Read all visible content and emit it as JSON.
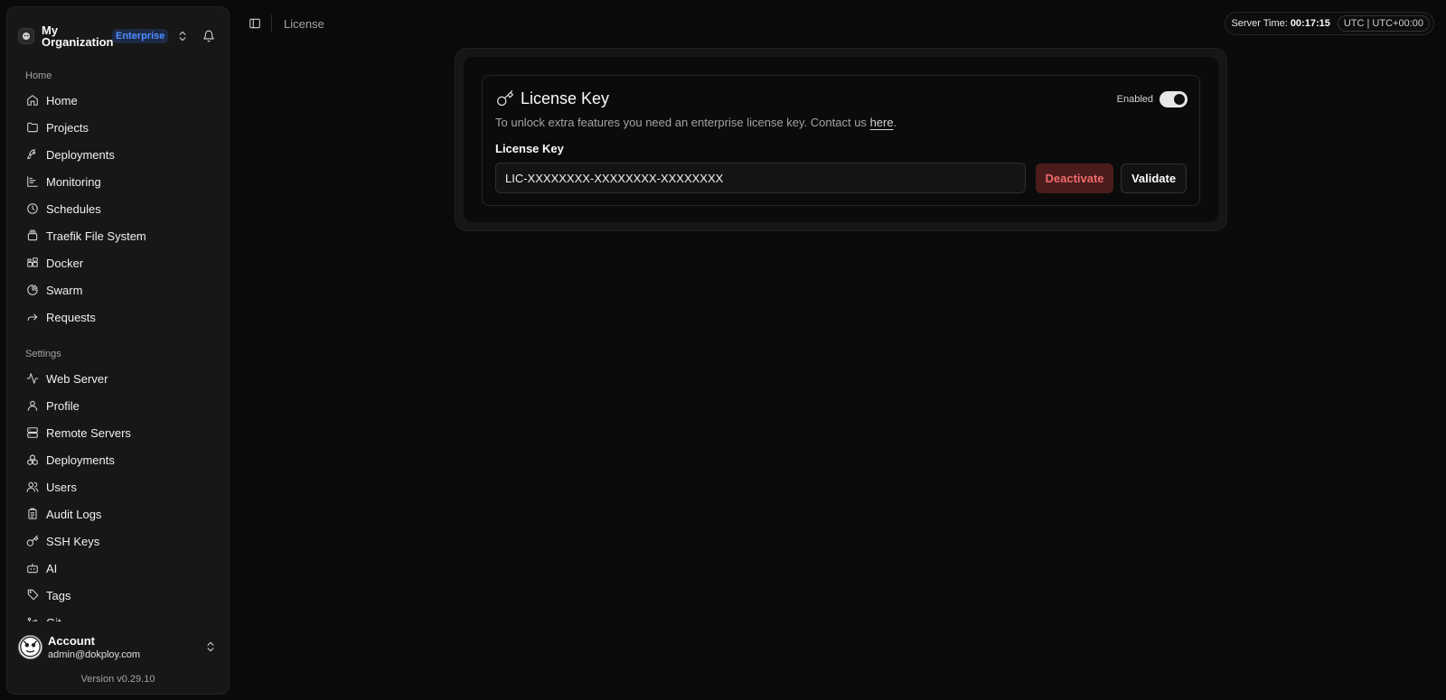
{
  "sidebar": {
    "org_name": "My Organization",
    "org_badge": "Enterprise",
    "groups": [
      {
        "label": "Home",
        "items": [
          {
            "label": "Home",
            "icon": "home-icon"
          },
          {
            "label": "Projects",
            "icon": "folder-icon"
          },
          {
            "label": "Deployments",
            "icon": "rocket-icon"
          },
          {
            "label": "Monitoring",
            "icon": "chart-icon"
          },
          {
            "label": "Schedules",
            "icon": "clock-icon"
          },
          {
            "label": "Traefik File System",
            "icon": "stack-icon"
          },
          {
            "label": "Docker",
            "icon": "blocks-icon"
          },
          {
            "label": "Swarm",
            "icon": "pie-icon"
          },
          {
            "label": "Requests",
            "icon": "forward-icon"
          }
        ]
      },
      {
        "label": "Settings",
        "items": [
          {
            "label": "Web Server",
            "icon": "activity-icon"
          },
          {
            "label": "Profile",
            "icon": "user-icon"
          },
          {
            "label": "Remote Servers",
            "icon": "server-icon"
          },
          {
            "label": "Deployments",
            "icon": "boxes-icon"
          },
          {
            "label": "Users",
            "icon": "users-icon"
          },
          {
            "label": "Audit Logs",
            "icon": "clipboard-icon"
          },
          {
            "label": "SSH Keys",
            "icon": "key-icon"
          },
          {
            "label": "AI",
            "icon": "bot-icon"
          },
          {
            "label": "Tags",
            "icon": "tag-icon"
          },
          {
            "label": "Git",
            "icon": "git-icon"
          }
        ]
      }
    ],
    "account": {
      "name": "Account",
      "email": "admin@dokploy.com"
    },
    "version": "Version v0.29.10"
  },
  "header": {
    "breadcrumb": "License",
    "server_time_label": "Server Time:",
    "server_time_value": "00:17:15",
    "timezone": "UTC | UTC+00:00"
  },
  "license": {
    "title": "License Key",
    "toggle_label": "Enabled",
    "toggle_on": true,
    "description": "To unlock extra features you need an enterprise license key. Contact us",
    "link_text": "here",
    "description_end": ".",
    "field_label": "License Key",
    "key_value": "LIC-XXXXXXXX-XXXXXXXX-XXXXXXXX",
    "deactivate_label": "Deactivate",
    "validate_label": "Validate"
  },
  "colors": {
    "background": "#0a0a0a",
    "sidebar": "#171717",
    "badge_text": "#4c8dff",
    "danger_text": "#f06a6a",
    "danger_bg": "#4a1c1c"
  }
}
